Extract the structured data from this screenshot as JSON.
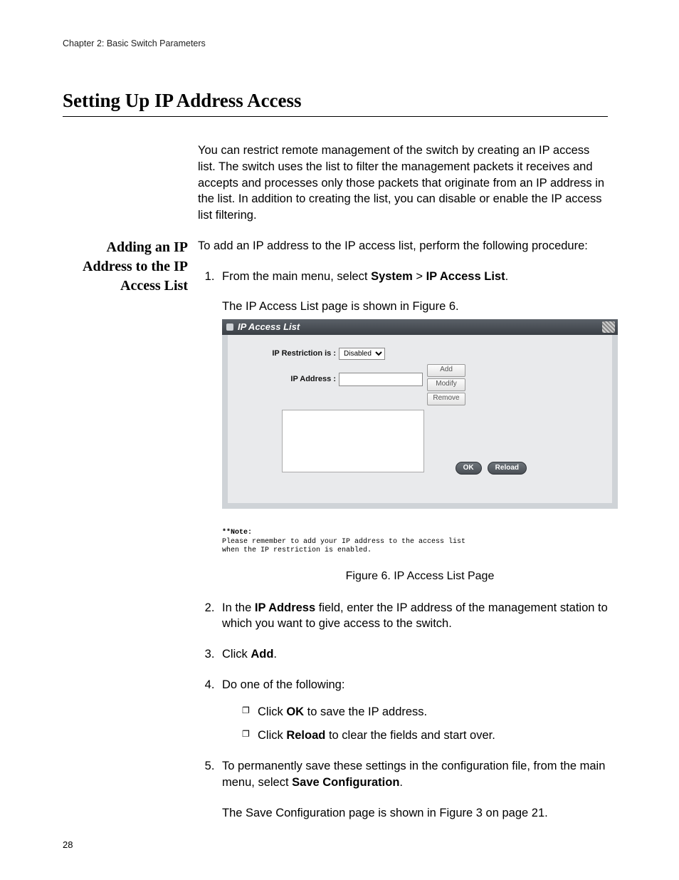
{
  "chapter_header": "Chapter 2: Basic Switch Parameters",
  "section_title": "Setting Up IP Address Access",
  "intro_para": "You can restrict remote management of the switch by creating an IP access list. The switch uses the list to filter the management packets it receives and accepts and processes only those packets that originate from an IP address in the list. In addition to creating the list, you can disable or enable the IP access list filtering.",
  "subsection_title": "Adding an IP Address to the IP Access List",
  "subsection_intro": "To add an IP address to the IP access list, perform the following procedure:",
  "steps": {
    "s1_pre": "From the main menu, select ",
    "s1_b1": "System",
    "s1_mid": " > ",
    "s1_b2": "IP Access List",
    "s1_post": ".",
    "s1_after": "The IP Access List page is shown in Figure 6.",
    "s2_pre": "In the ",
    "s2_b1": "IP Address",
    "s2_post": " field, enter the IP address of the management station to which you want to give access to the switch.",
    "s3_pre": "Click ",
    "s3_b1": "Add",
    "s3_post": ".",
    "s4_text": "Do one of the following:",
    "s4_a_pre": "Click ",
    "s4_a_b": "OK",
    "s4_a_post": " to save the IP address.",
    "s4_b_pre": "Click ",
    "s4_b_b": "Reload",
    "s4_b_post": " to clear the fields and start over.",
    "s5_pre": "To permanently save these settings in the configuration file, from the main menu, select ",
    "s5_b1": "Save Configuration",
    "s5_post": ".",
    "s5_after": "The Save Configuration page is shown in Figure 3 on page 21."
  },
  "figure": {
    "titlebar": "IP Access List",
    "label_restriction": "IP Restriction is :",
    "select_value": "Disabled",
    "label_ip": "IP Address :",
    "btn_add": "Add",
    "btn_modify": "Modify",
    "btn_remove": "Remove",
    "btn_ok": "OK",
    "btn_reload": "Reload",
    "note_head": "**Note:",
    "note_body1": "  Please remember to add your IP address to the access list",
    "note_body2": "  when the IP restriction is enabled.",
    "caption": "Figure 6. IP Access List Page"
  },
  "page_number": "28"
}
